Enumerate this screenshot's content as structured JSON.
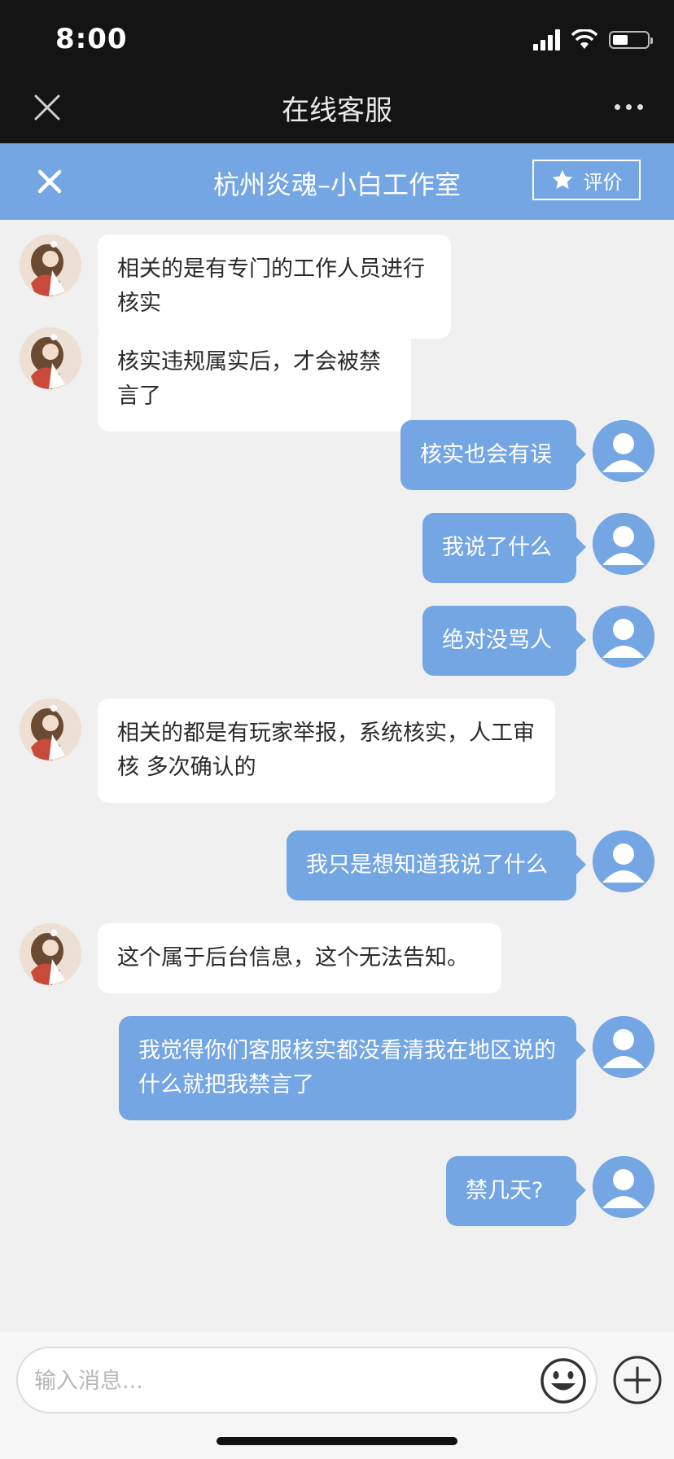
{
  "status_bar": {
    "time": "8:00"
  },
  "nav": {
    "title": "在线客服"
  },
  "header": {
    "title": "杭州炎魂–小白工作室",
    "rate_label": "评价"
  },
  "messages": [
    {
      "from": "agent",
      "text": "相关的是有专门的工作人员进行核实"
    },
    {
      "from": "agent",
      "text": "核实违规属实后，才会被禁言了"
    },
    {
      "from": "user",
      "text": "核实也会有误"
    },
    {
      "from": "user",
      "text": "我说了什么"
    },
    {
      "from": "user",
      "text": "绝对没骂人"
    },
    {
      "from": "agent",
      "text": "相关的都是有玩家举报，系统核实，人工审核 多次确认的"
    },
    {
      "from": "user",
      "text": "我只是想知道我说了什么"
    },
    {
      "from": "agent",
      "text": "这个属于后台信息，这个无法告知。"
    },
    {
      "from": "user",
      "text": "我觉得你们客服核实都没看清我在地区说的什么就把我禁言了"
    },
    {
      "from": "user",
      "text": "禁几天?"
    }
  ],
  "input": {
    "placeholder": "输入消息...",
    "value": ""
  },
  "colors": {
    "accent": "#74a6e4",
    "nav_bg": "#141414",
    "chat_bg": "#f0f0f0"
  },
  "icons": [
    "close-icon",
    "more-icon",
    "star-icon",
    "user-avatar-icon",
    "emoji-icon",
    "plus-icon"
  ]
}
